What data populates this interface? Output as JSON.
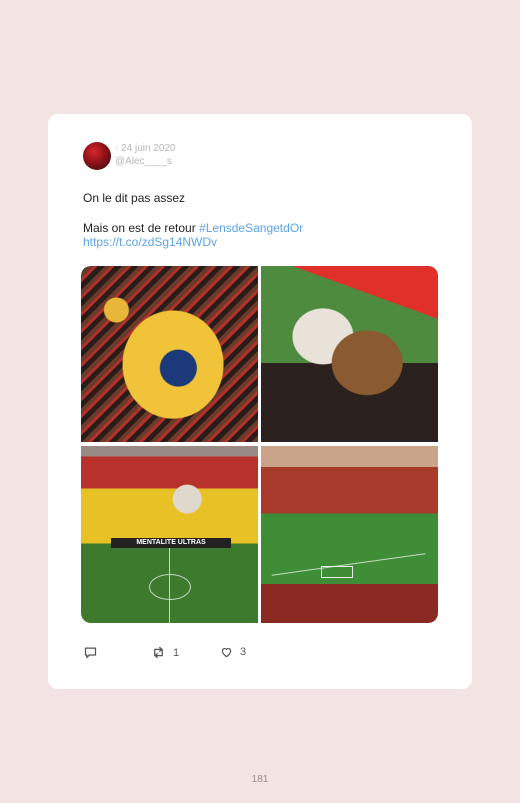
{
  "tweet": {
    "date": "· 24 juin 2020",
    "handle": "@Alec____s",
    "line1": "On le dit pas assez",
    "line2_prefix": "Mais on est de retour ",
    "hashtag": "#LensdeSangetdOr",
    "url": "https://t.co/zdSg14NWDv",
    "photos": [
      "ultras-tifo-flag",
      "fans-waving-flags",
      "stadium-banner-mentalite-ultras",
      "stadium-sunset-view"
    ],
    "banner_text": "MENTALITE ULTRAS"
  },
  "actions": {
    "reply_icon": "reply-icon",
    "retweet_icon": "retweet-icon",
    "retweet_count": "1",
    "like_icon": "heart-icon",
    "like_count": "3"
  },
  "page": {
    "number": "181"
  },
  "colors": {
    "background": "#f4e3e3",
    "link": "#5aa4e8",
    "card": "#ffffff"
  }
}
